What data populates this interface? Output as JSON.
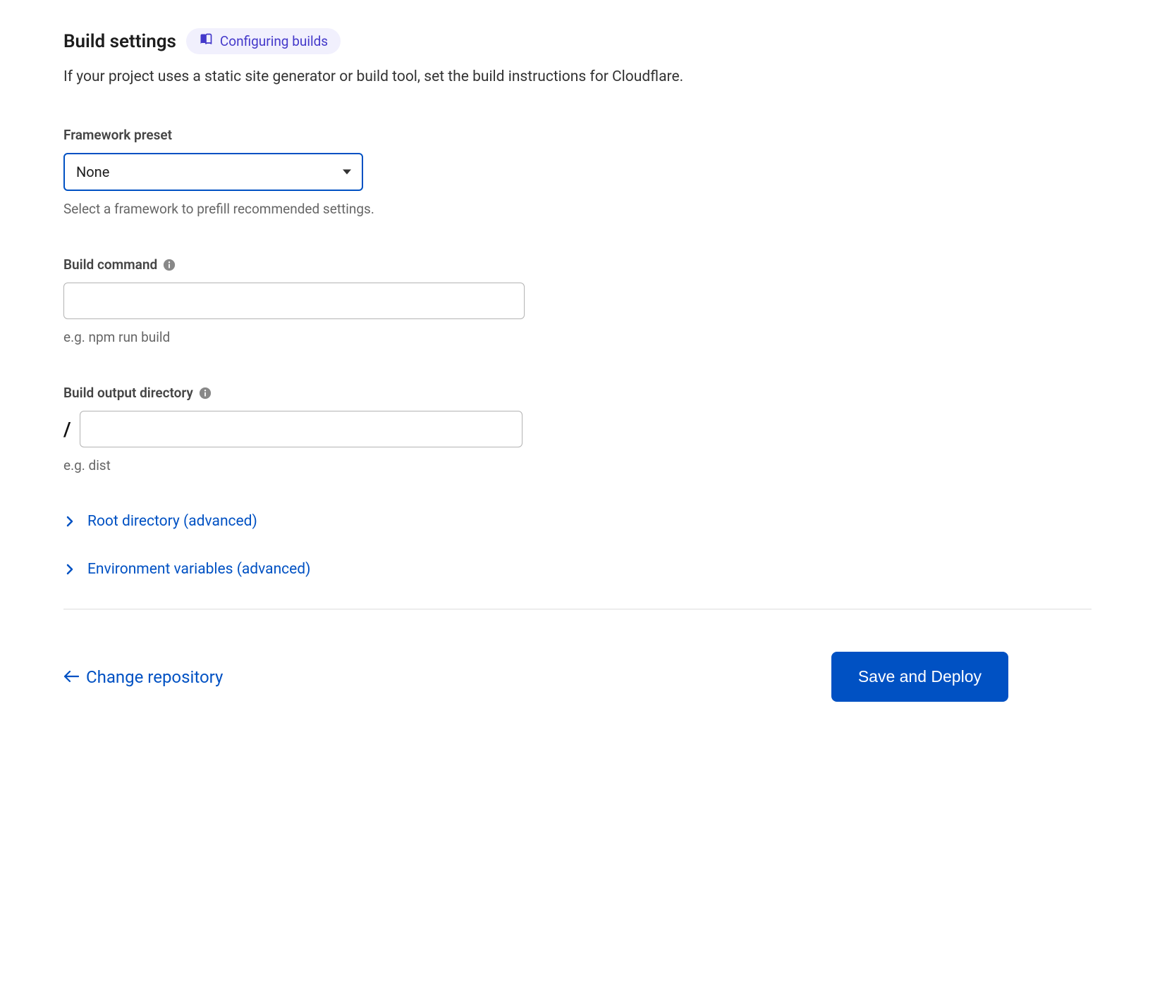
{
  "header": {
    "title": "Build settings",
    "docs_link": "Configuring builds"
  },
  "description": "If your project uses a static site generator or build tool, set the build instructions for Cloudflare.",
  "framework": {
    "label": "Framework preset",
    "value": "None",
    "help": "Select a framework to prefill recommended settings."
  },
  "build_command": {
    "label": "Build command",
    "value": "",
    "help": "e.g. npm run build"
  },
  "output_dir": {
    "label": "Build output directory",
    "prefix": "/",
    "value": "",
    "help": "e.g. dist"
  },
  "expanders": {
    "root_dir": "Root directory (advanced)",
    "env_vars": "Environment variables (advanced)"
  },
  "footer": {
    "back": "Change repository",
    "submit": "Save and Deploy"
  }
}
